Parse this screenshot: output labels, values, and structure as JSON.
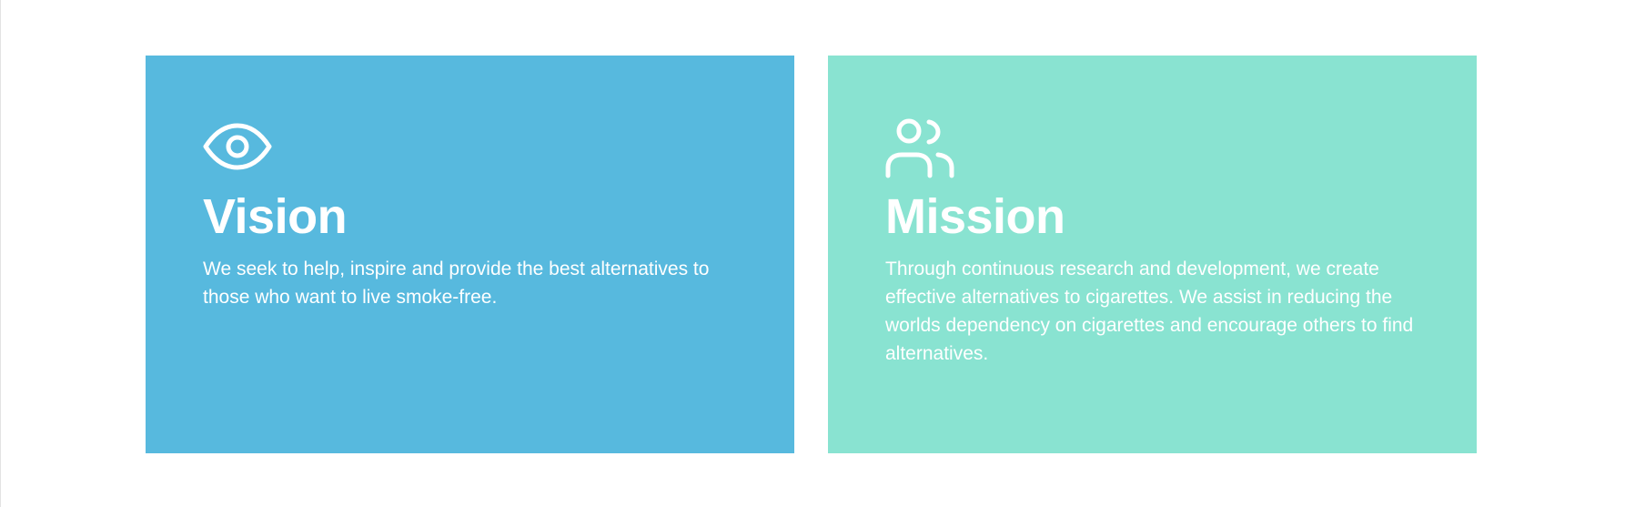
{
  "cards": [
    {
      "icon": "eye-icon",
      "title": "Vision",
      "description": "We seek to help, inspire and provide the best alternatives to those who want to live smoke-free.",
      "background": "#57b9de"
    },
    {
      "icon": "users-icon",
      "title": "Mission",
      "description": "Through continuous research and development, we create effective alternatives to cigarettes. We assist in reducing the worlds dependency on cigarettes and encourage others to find alternatives.",
      "background": "#89e3d1"
    }
  ]
}
